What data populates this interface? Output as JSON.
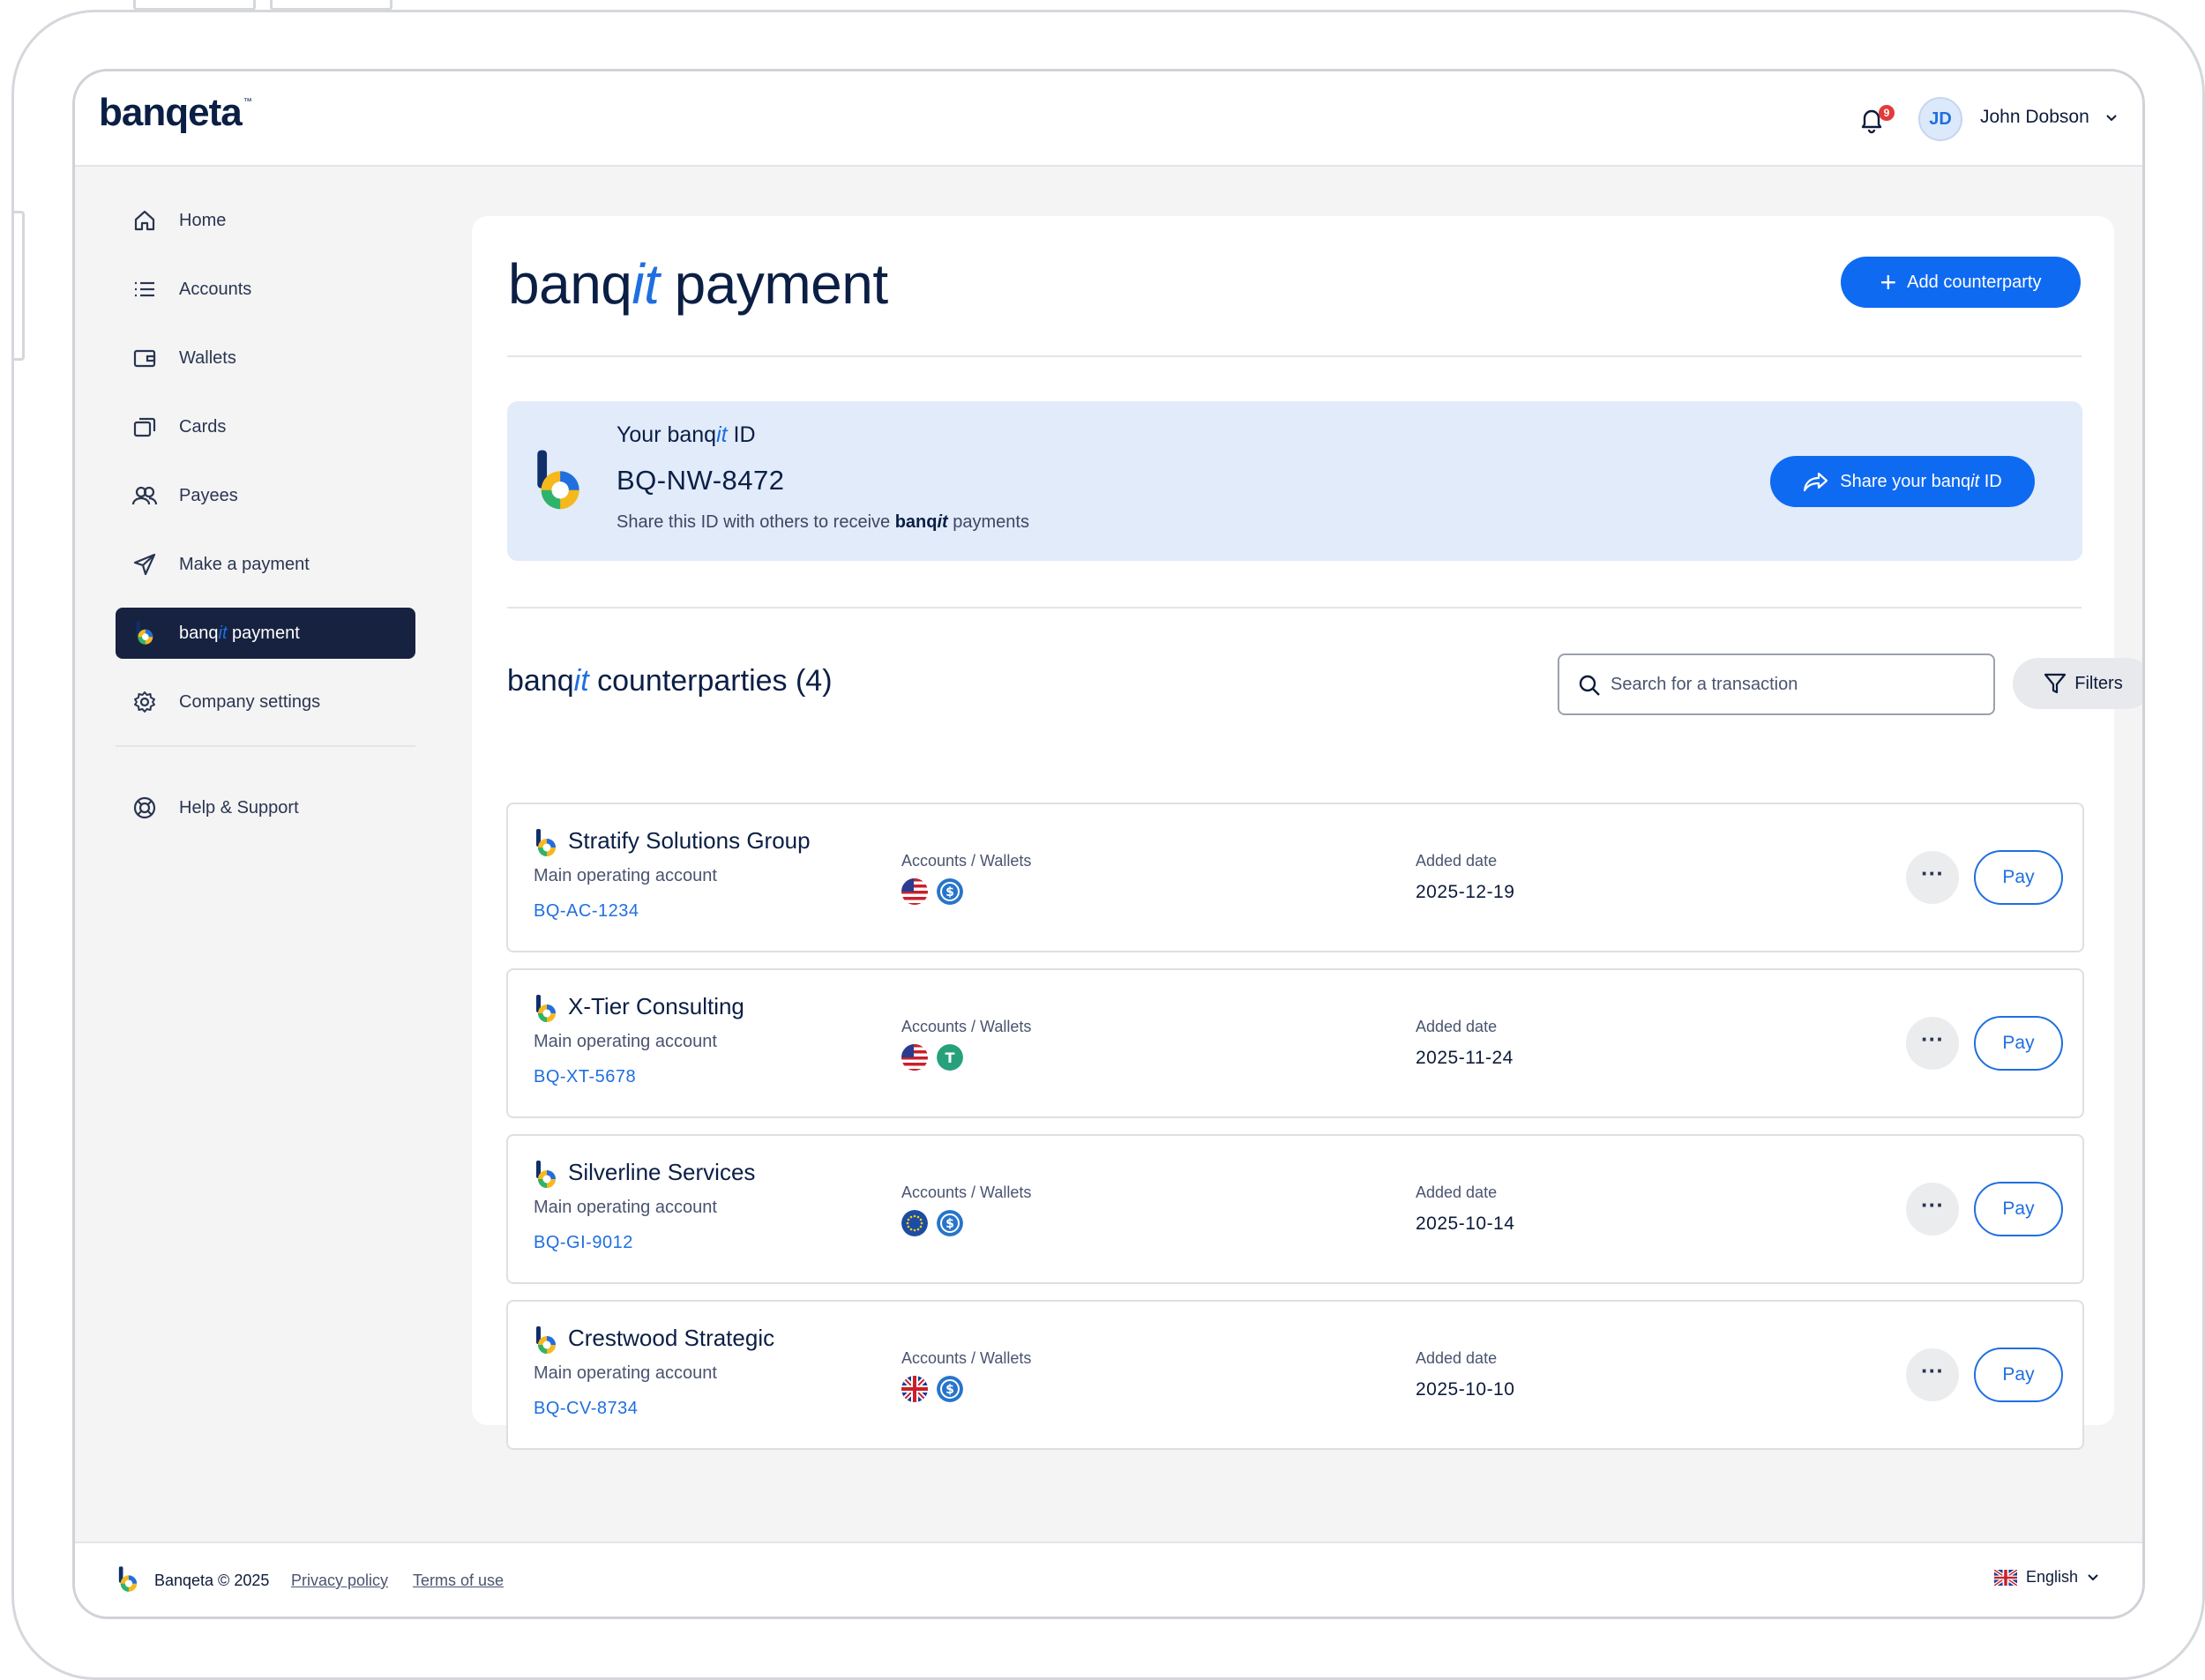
{
  "app": {
    "logo_text": "banqeta",
    "logo_tm": "™"
  },
  "header": {
    "notifications_count": "9",
    "user_initials": "JD",
    "user_name": "John Dobson"
  },
  "sidebar": {
    "items": [
      {
        "label": "Home",
        "icon": "home-icon"
      },
      {
        "label": "Accounts",
        "icon": "list-icon"
      },
      {
        "label": "Wallets",
        "icon": "wallet-icon"
      },
      {
        "label": "Cards",
        "icon": "cards-icon"
      },
      {
        "label": "Payees",
        "icon": "users-icon"
      },
      {
        "label": "Make a payment",
        "icon": "send-icon"
      },
      {
        "label_prefix": "banq",
        "label_it": "it",
        "label_suffix": " payment",
        "icon": "banqit-logo-icon",
        "active": true
      },
      {
        "label": "Company settings",
        "icon": "gear-icon"
      }
    ],
    "help": {
      "label": "Help & Support",
      "icon": "lifebuoy-icon"
    }
  },
  "main": {
    "title_prefix": "banq",
    "title_it": "it",
    "title_suffix": " payment",
    "add_button": "Add counterparty",
    "id_card": {
      "label_prefix": "Your banq",
      "label_it": "it",
      "label_suffix": " ID",
      "value": "BQ-NW-8472",
      "help_prefix": "Share this ID with others to receive ",
      "help_em_prefix": "banq",
      "help_em_it": "it",
      "help_suffix": " payments",
      "share_prefix": "Share your banq",
      "share_it": "it",
      "share_suffix": " ID"
    },
    "counterparties": {
      "title_prefix": "banq",
      "title_it": "it",
      "title_suffix": " counterparties (4)",
      "search_placeholder": "Search for a transaction",
      "filters_label": "Filters",
      "col_accounts": "Accounts / Wallets",
      "col_added": "Added date",
      "more_label": "···",
      "pay_label": "Pay",
      "rows": [
        {
          "name": "Stratify Solutions Group",
          "sub": "Main operating account",
          "code": "BQ-AC-1234",
          "date": "2025-12-19",
          "flags": [
            "us-flag-icon",
            "usd-coin-icon"
          ]
        },
        {
          "name": "X-Tier Consulting",
          "sub": "Main operating account",
          "code": "BQ-XT-5678",
          "date": "2025-11-24",
          "flags": [
            "us-flag-icon",
            "tether-icon"
          ]
        },
        {
          "name": "Silverline Services",
          "sub": "Main operating account",
          "code": "BQ-GI-9012",
          "date": "2025-10-14",
          "flags": [
            "eu-flag-icon",
            "usd-coin-icon"
          ]
        },
        {
          "name": "Crestwood Strategic",
          "sub": "Main operating account",
          "code": "BQ-CV-8734",
          "date": "2025-10-10",
          "flags": [
            "uk-flag-icon",
            "usd-coin-icon"
          ]
        }
      ]
    }
  },
  "footer": {
    "copyright": "Banqeta © 2025",
    "privacy": "Privacy policy",
    "terms": "Terms of use",
    "language": "English"
  },
  "colors": {
    "primary": "#0f6af2",
    "navy": "#172240",
    "accent_text": "#1f6fe0",
    "id_card_bg": "#e1ebfa",
    "badge_red": "#e23b3b"
  }
}
